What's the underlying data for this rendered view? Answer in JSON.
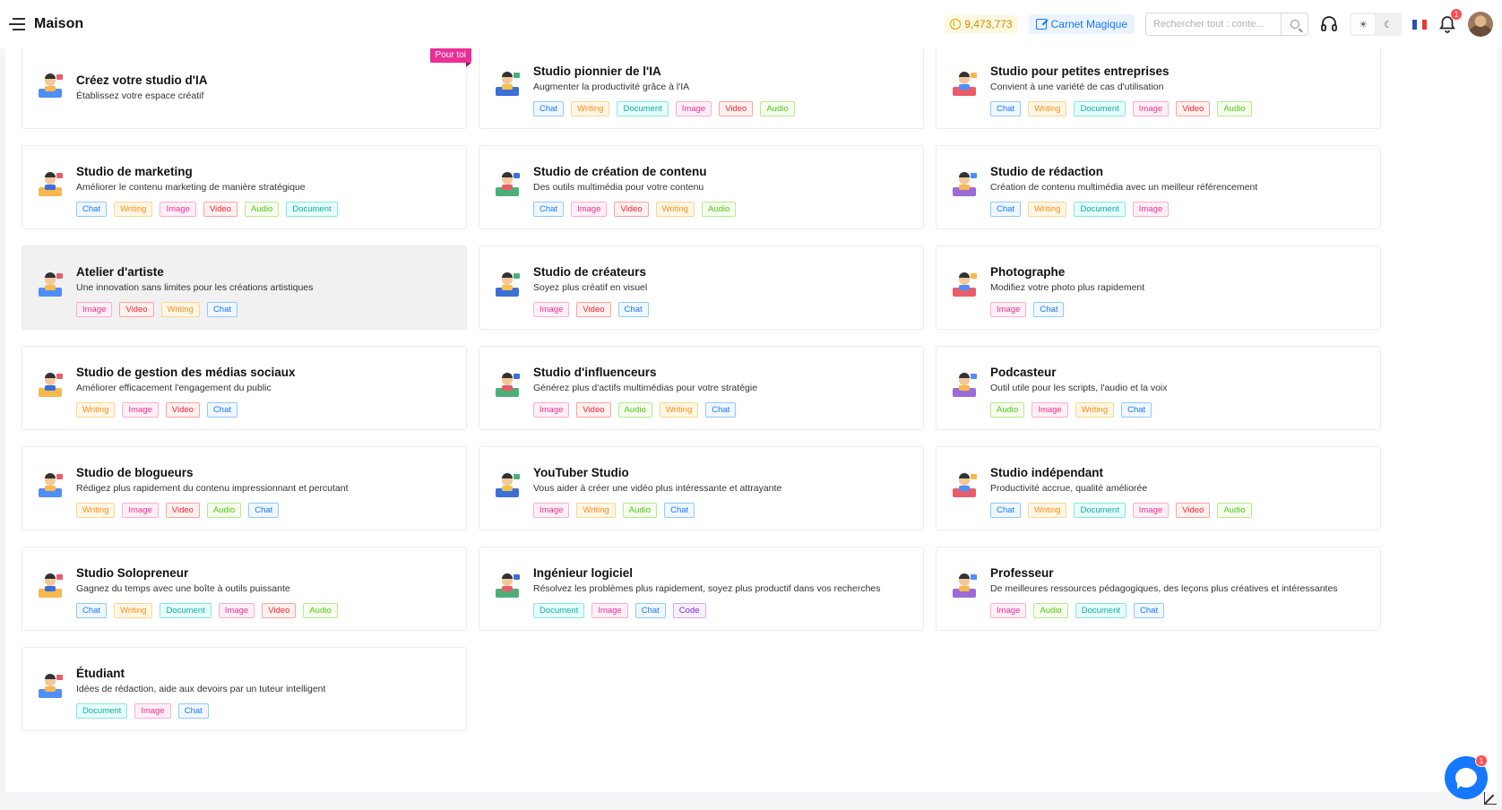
{
  "header": {
    "title": "Maison",
    "credits": "9,473,773",
    "notebook_label": "Carnet Magique",
    "search_placeholder": "Rechercher tout : conte...",
    "notification_count": "1",
    "theme_light": "☀",
    "theme_dark": "☾"
  },
  "colors": {
    "accent": "#1677ff",
    "ribbon": "#eb2f96",
    "coin": "#d18b00"
  },
  "cards": [
    {
      "title": "Créez votre studio d'IA",
      "desc": "Établissez votre espace créatif",
      "ribbon": "Pour toi",
      "icon": "studio-desk-icon",
      "tags": []
    },
    {
      "title": "Studio pionnier de l'IA",
      "desc": "Augmenter la productivité grâce à l'IA",
      "icon": "ai-pioneer-icon",
      "tags": [
        {
          "label": "Chat",
          "type": "chat"
        },
        {
          "label": "Writing",
          "type": "writing"
        },
        {
          "label": "Document",
          "type": "document"
        },
        {
          "label": "Image",
          "type": "image"
        },
        {
          "label": "Video",
          "type": "video"
        },
        {
          "label": "Audio",
          "type": "audio"
        }
      ]
    },
    {
      "title": "Studio pour petites entreprises",
      "desc": "Convient à une variété de cas d'utilisation",
      "icon": "shop-icon",
      "tags": [
        {
          "label": "Chat",
          "type": "chat"
        },
        {
          "label": "Writing",
          "type": "writing"
        },
        {
          "label": "Document",
          "type": "document"
        },
        {
          "label": "Image",
          "type": "image"
        },
        {
          "label": "Video",
          "type": "video"
        },
        {
          "label": "Audio",
          "type": "audio"
        }
      ]
    },
    {
      "title": "Studio de marketing",
      "desc": "Améliorer le contenu marketing de manière stratégique",
      "icon": "marketer-icon",
      "tags": [
        {
          "label": "Chat",
          "type": "chat"
        },
        {
          "label": "Writing",
          "type": "writing"
        },
        {
          "label": "Image",
          "type": "image"
        },
        {
          "label": "Video",
          "type": "video"
        },
        {
          "label": "Audio",
          "type": "audio"
        },
        {
          "label": "Document",
          "type": "document"
        }
      ]
    },
    {
      "title": "Studio de création de contenu",
      "desc": "Des outils multimédia pour votre contenu",
      "icon": "content-creator-icon",
      "tags": [
        {
          "label": "Chat",
          "type": "chat"
        },
        {
          "label": "Image",
          "type": "image"
        },
        {
          "label": "Video",
          "type": "video"
        },
        {
          "label": "Writing",
          "type": "writing"
        },
        {
          "label": "Audio",
          "type": "audio"
        }
      ]
    },
    {
      "title": "Studio de rédaction",
      "desc": "Création de contenu multimédia avec un meilleur référencement",
      "icon": "writer-icon",
      "tags": [
        {
          "label": "Chat",
          "type": "chat"
        },
        {
          "label": "Writing",
          "type": "writing"
        },
        {
          "label": "Document",
          "type": "document"
        },
        {
          "label": "Image",
          "type": "image"
        }
      ]
    },
    {
      "title": "Atelier d'artiste",
      "desc": "Une innovation sans limites pour les créations artistiques",
      "icon": "artist-icon",
      "hover": true,
      "tags": [
        {
          "label": "Image",
          "type": "image"
        },
        {
          "label": "Video",
          "type": "video"
        },
        {
          "label": "Writing",
          "type": "writing"
        },
        {
          "label": "Chat",
          "type": "chat"
        }
      ]
    },
    {
      "title": "Studio de créateurs",
      "desc": "Soyez plus créatif en visuel",
      "icon": "creator-icon",
      "tags": [
        {
          "label": "Image",
          "type": "image"
        },
        {
          "label": "Video",
          "type": "video"
        },
        {
          "label": "Chat",
          "type": "chat"
        }
      ]
    },
    {
      "title": "Photographe",
      "desc": "Modifiez votre photo plus rapidement",
      "icon": "photographer-icon",
      "tags": [
        {
          "label": "Image",
          "type": "image"
        },
        {
          "label": "Chat",
          "type": "chat"
        }
      ]
    },
    {
      "title": "Studio de gestion des médias sociaux",
      "desc": "Améliorer efficacement l'engagement du public",
      "icon": "social-media-icon",
      "tags": [
        {
          "label": "Writing",
          "type": "writing"
        },
        {
          "label": "Image",
          "type": "image"
        },
        {
          "label": "Video",
          "type": "video"
        },
        {
          "label": "Chat",
          "type": "chat"
        }
      ]
    },
    {
      "title": "Studio d'influenceurs",
      "desc": "Générez plus d'actifs multimédias pour votre stratégie",
      "icon": "influencer-icon",
      "tags": [
        {
          "label": "Image",
          "type": "image"
        },
        {
          "label": "Video",
          "type": "video"
        },
        {
          "label": "Audio",
          "type": "audio"
        },
        {
          "label": "Writing",
          "type": "writing"
        },
        {
          "label": "Chat",
          "type": "chat"
        }
      ]
    },
    {
      "title": "Podcasteur",
      "desc": "Outil utile pour les scripts, l'audio et la voix",
      "icon": "podcaster-icon",
      "tags": [
        {
          "label": "Audio",
          "type": "audio"
        },
        {
          "label": "Image",
          "type": "image"
        },
        {
          "label": "Writing",
          "type": "writing"
        },
        {
          "label": "Chat",
          "type": "chat"
        }
      ]
    },
    {
      "title": "Studio de blogueurs",
      "desc": "Rédigez plus rapidement du contenu impressionnant et percutant",
      "icon": "blogger-icon",
      "tags": [
        {
          "label": "Writing",
          "type": "writing"
        },
        {
          "label": "Image",
          "type": "image"
        },
        {
          "label": "Video",
          "type": "video"
        },
        {
          "label": "Audio",
          "type": "audio"
        },
        {
          "label": "Chat",
          "type": "chat"
        }
      ]
    },
    {
      "title": "YouTuber Studio",
      "desc": "Vous aider à créer une vidéo plus intéressante et attrayante",
      "icon": "youtuber-icon",
      "tags": [
        {
          "label": "Image",
          "type": "image"
        },
        {
          "label": "Writing",
          "type": "writing"
        },
        {
          "label": "Audio",
          "type": "audio"
        },
        {
          "label": "Chat",
          "type": "chat"
        }
      ]
    },
    {
      "title": "Studio indépendant",
      "desc": "Productivité accrue, qualité améliorée",
      "icon": "freelancer-icon",
      "tags": [
        {
          "label": "Chat",
          "type": "chat"
        },
        {
          "label": "Writing",
          "type": "writing"
        },
        {
          "label": "Document",
          "type": "document"
        },
        {
          "label": "Image",
          "type": "image"
        },
        {
          "label": "Video",
          "type": "video"
        },
        {
          "label": "Audio",
          "type": "audio"
        }
      ]
    },
    {
      "title": "Studio Solopreneur",
      "desc": "Gagnez du temps avec une boîte à outils puissante",
      "icon": "solopreneur-icon",
      "tags": [
        {
          "label": "Chat",
          "type": "chat"
        },
        {
          "label": "Writing",
          "type": "writing"
        },
        {
          "label": "Document",
          "type": "document"
        },
        {
          "label": "Image",
          "type": "image"
        },
        {
          "label": "Video",
          "type": "video"
        },
        {
          "label": "Audio",
          "type": "audio"
        }
      ]
    },
    {
      "title": "Ingénieur logiciel",
      "desc": "Résolvez les problèmes plus rapidement, soyez plus productif dans vos recherches",
      "icon": "software-engineer-icon",
      "tags": [
        {
          "label": "Document",
          "type": "document"
        },
        {
          "label": "Image",
          "type": "image"
        },
        {
          "label": "Chat",
          "type": "chat"
        },
        {
          "label": "Code",
          "type": "code"
        }
      ]
    },
    {
      "title": "Professeur",
      "desc": "De meilleures ressources pédagogiques, des leçons plus créatives et intéressantes",
      "icon": "teacher-icon",
      "tags": [
        {
          "label": "Image",
          "type": "image"
        },
        {
          "label": "Audio",
          "type": "audio"
        },
        {
          "label": "Document",
          "type": "document"
        },
        {
          "label": "Chat",
          "type": "chat"
        }
      ]
    },
    {
      "title": "Étudiant",
      "desc": "Idées de rédaction, aide aux devoirs par un tuteur intelligent",
      "icon": "student-icon",
      "tags": [
        {
          "label": "Document",
          "type": "document"
        },
        {
          "label": "Image",
          "type": "image"
        },
        {
          "label": "Chat",
          "type": "chat"
        }
      ]
    }
  ],
  "chat_widget": {
    "badge": "1"
  }
}
